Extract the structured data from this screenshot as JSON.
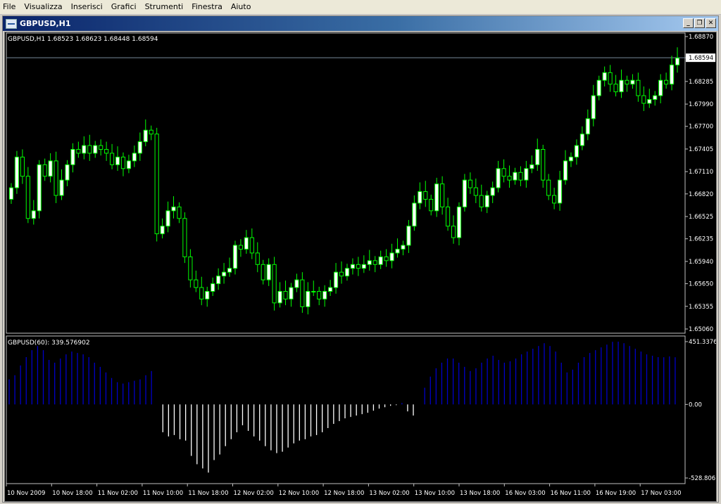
{
  "menu": [
    "File",
    "Visualizza",
    "Inserisci",
    "Grafici",
    "Strumenti",
    "Finestra",
    "Aiuto"
  ],
  "window": {
    "title": "GBPUSD,H1",
    "minimize_icon": "minimize-icon",
    "restore_icon": "restore-icon",
    "close_icon": "close-icon"
  },
  "price_panel": {
    "header": "GBPUSD,H1  1.68523 1.68623 1.68448 1.68594",
    "current_price": 1.68594,
    "current_price_label": "1.68594"
  },
  "indicator_panel": {
    "header": "GBPUSD(60):  339.576902",
    "axis_labels": [
      "451.3376",
      "0.00",
      "-528.806"
    ]
  },
  "colors": {
    "background": "#000000",
    "candle_bull": "#ffffff",
    "candle_bear": "#000000",
    "candle_outline": "#00ff00",
    "histogram_positive": "#0000c8",
    "histogram_negative": "#ffffff",
    "text": "#ffffff",
    "price_line": "#778899"
  },
  "chart_data": [
    {
      "type": "candlestick",
      "title": "GBPUSD,H1",
      "ylim": [
        1.6506,
        1.6887
      ],
      "y_ticks": [
        "1.68870",
        "1.68594",
        "1.68285",
        "1.67990",
        "1.67700",
        "1.67405",
        "1.67110",
        "1.66820",
        "1.66525",
        "1.66235",
        "1.65940",
        "1.65650",
        "1.65355",
        "1.65060"
      ],
      "x_tick_labels": [
        "10 Nov 2009",
        "10 Nov 18:00",
        "11 Nov 02:00",
        "11 Nov 10:00",
        "11 Nov 18:00",
        "12 Nov 02:00",
        "12 Nov 10:00",
        "12 Nov 18:00",
        "13 Nov 02:00",
        "13 Nov 10:00",
        "13 Nov 18:00",
        "16 Nov 03:00",
        "16 Nov 11:00",
        "16 Nov 19:00",
        "17 Nov 03:00"
      ],
      "close": [
        1.669,
        1.673,
        1.6705,
        1.665,
        1.666,
        1.672,
        1.6705,
        1.6725,
        1.668,
        1.67,
        1.672,
        1.674,
        1.6735,
        1.6745,
        1.6735,
        1.6745,
        1.674,
        1.6735,
        1.672,
        1.673,
        1.6715,
        1.6725,
        1.6735,
        1.675,
        1.6765,
        1.676,
        1.663,
        1.664,
        1.666,
        1.6665,
        1.665,
        1.66,
        1.657,
        1.656,
        1.6545,
        1.6555,
        1.6565,
        1.6575,
        1.658,
        1.6585,
        1.6615,
        1.661,
        1.6625,
        1.6605,
        1.659,
        1.657,
        1.659,
        1.654,
        1.6555,
        1.6545,
        1.656,
        1.657,
        1.6535,
        1.6555,
        1.6555,
        1.6545,
        1.6555,
        1.656,
        1.658,
        1.6575,
        1.6585,
        1.659,
        1.6585,
        1.659,
        1.6595,
        1.659,
        1.66,
        1.6595,
        1.6605,
        1.661,
        1.6615,
        1.664,
        1.667,
        1.6685,
        1.6675,
        1.666,
        1.6695,
        1.6665,
        1.664,
        1.6625,
        1.6665,
        1.67,
        1.669,
        1.668,
        1.6665,
        1.668,
        1.669,
        1.6715,
        1.6705,
        1.67,
        1.671,
        1.67,
        1.6715,
        1.672,
        1.674,
        1.67,
        1.668,
        1.667,
        1.67,
        1.6725,
        1.673,
        1.6745,
        1.676,
        1.678,
        1.681,
        1.683,
        1.684,
        1.6825,
        1.6815,
        1.683,
        1.6825,
        1.683,
        1.681,
        1.68,
        1.6805,
        1.681,
        1.683,
        1.6825,
        1.685,
        1.6859
      ]
    },
    {
      "type": "bar",
      "title": "GBPUSD(60)",
      "last_value": 339.576902,
      "ylim": [
        -528.806,
        451.3376
      ],
      "values": [
        180,
        210,
        280,
        340,
        390,
        420,
        390,
        320,
        300,
        330,
        360,
        380,
        370,
        360,
        340,
        300,
        270,
        230,
        190,
        160,
        150,
        160,
        170,
        180,
        210,
        240,
        0,
        -200,
        -230,
        -220,
        -250,
        -260,
        -370,
        -430,
        -460,
        -490,
        -400,
        -360,
        -300,
        -250,
        -200,
        -150,
        -190,
        -230,
        -260,
        -300,
        -330,
        -350,
        -340,
        -310,
        -280,
        -260,
        -250,
        -230,
        -220,
        -200,
        -170,
        -140,
        -120,
        -100,
        -90,
        -80,
        -70,
        -60,
        -45,
        -30,
        -20,
        -10,
        -5,
        10,
        -50,
        -80,
        0,
        120,
        200,
        260,
        300,
        330,
        330,
        300,
        270,
        240,
        260,
        300,
        330,
        350,
        320,
        300,
        310,
        330,
        360,
        380,
        400,
        420,
        440,
        420,
        380,
        300,
        230,
        250,
        300,
        340,
        370,
        390,
        410,
        430,
        450,
        451,
        440,
        420,
        400,
        380,
        360,
        350,
        340,
        339,
        345,
        339
      ]
    }
  ]
}
